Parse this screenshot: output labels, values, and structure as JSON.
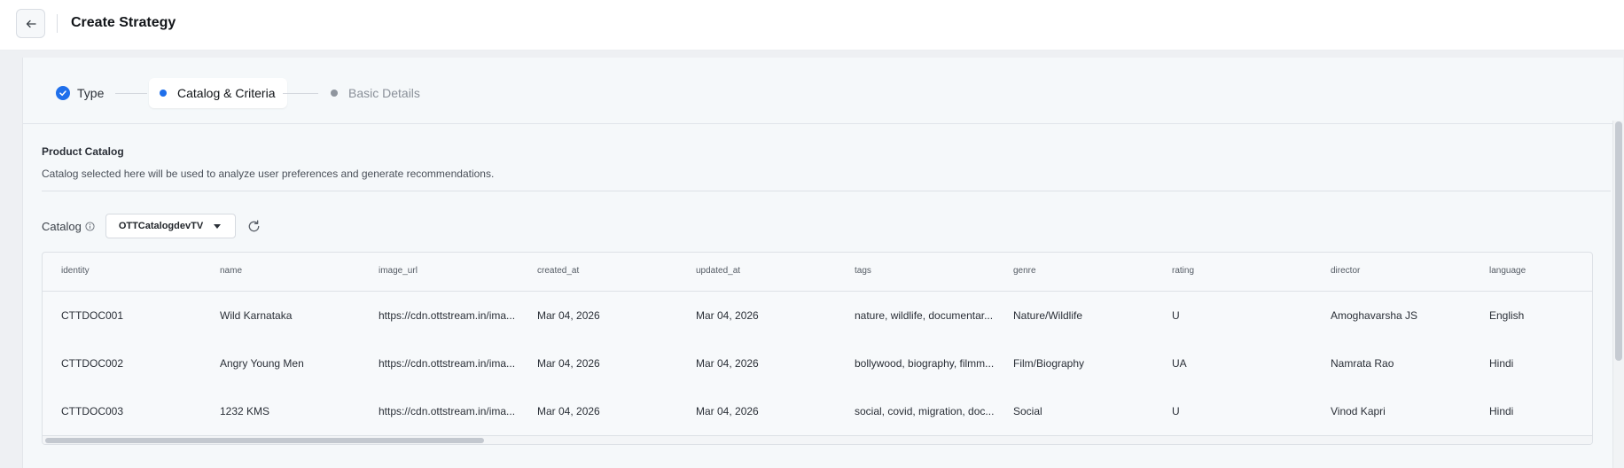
{
  "header": {
    "title": "Create Strategy"
  },
  "stepper": {
    "steps": [
      {
        "label": "Type",
        "state": "done"
      },
      {
        "label": "Catalog & Criteria",
        "state": "active"
      },
      {
        "label": "Basic Details",
        "state": "pending"
      }
    ]
  },
  "catalog_section": {
    "title": "Product Catalog",
    "description": "Catalog selected here will be used to analyze user preferences and generate recommendations.",
    "catalog_label": "Catalog",
    "selected_catalog": "OTTCatalogdevTV"
  },
  "table": {
    "columns": [
      "identity",
      "name",
      "image_url",
      "created_at",
      "updated_at",
      "tags",
      "genre",
      "rating",
      "director",
      "language"
    ],
    "rows": [
      [
        "CTTDOC001",
        "Wild Karnataka",
        "https://cdn.ottstream.in/ima...",
        "Mar 04, 2026",
        "Mar 04, 2026",
        "nature, wildlife, documentar...",
        "Nature/Wildlife",
        "U",
        "Amoghavarsha JS",
        "English"
      ],
      [
        "CTTDOC002",
        "Angry Young Men",
        "https://cdn.ottstream.in/ima...",
        "Mar 04, 2026",
        "Mar 04, 2026",
        "bollywood, biography, filmm...",
        "Film/Biography",
        "UA",
        "Namrata Rao",
        "Hindi"
      ],
      [
        "CTTDOC003",
        "1232 KMS",
        "https://cdn.ottstream.in/ima...",
        "Mar 04, 2026",
        "Mar 04, 2026",
        "social, covid, migration, doc...",
        "Social",
        "U",
        "Vinod Kapri",
        "Hindi"
      ]
    ]
  },
  "colors": {
    "accent": "#1f6feb",
    "pending": "#8f959e"
  }
}
